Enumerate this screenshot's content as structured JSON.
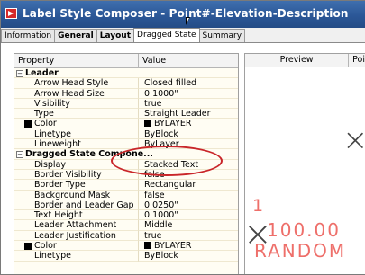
{
  "window": {
    "title": "Label Style Composer - Point#-Elevation-Description"
  },
  "tabs": [
    {
      "label": "Information",
      "bold": false,
      "active": false
    },
    {
      "label": "General",
      "bold": true,
      "active": false
    },
    {
      "label": "Layout",
      "bold": true,
      "active": false
    },
    {
      "label": "Dragged State",
      "bold": false,
      "active": true
    },
    {
      "label": "Summary",
      "bold": false,
      "active": false
    }
  ],
  "grid": {
    "property_header": "Property",
    "value_header": "Value",
    "rows": [
      {
        "kind": "cat",
        "label": "Leader",
        "toggle": "−"
      },
      {
        "kind": "item",
        "label": "Arrow Head Style",
        "value": "Closed filled"
      },
      {
        "kind": "item",
        "label": "Arrow Head Size",
        "value": "0.1000\""
      },
      {
        "kind": "item",
        "label": "Visibility",
        "value": "true"
      },
      {
        "kind": "item",
        "label": "Type",
        "value": "Straight Leader"
      },
      {
        "kind": "item",
        "label": "Color",
        "value": "BYLAYER",
        "swatch": true
      },
      {
        "kind": "item",
        "label": "Linetype",
        "value": "ByBlock"
      },
      {
        "kind": "item",
        "label": "Lineweight",
        "value": "ByLayer"
      },
      {
        "kind": "cat",
        "label": "Dragged State Compone...",
        "toggle": "−"
      },
      {
        "kind": "item",
        "label": "Display",
        "value": "Stacked Text"
      },
      {
        "kind": "item",
        "label": "Border Visibility",
        "value": "false"
      },
      {
        "kind": "item",
        "label": "Border Type",
        "value": "Rectangular"
      },
      {
        "kind": "item",
        "label": "Background Mask",
        "value": "false"
      },
      {
        "kind": "item",
        "label": "Border and Leader Gap",
        "value": "0.0250\""
      },
      {
        "kind": "item",
        "label": "Text Height",
        "value": "0.1000\""
      },
      {
        "kind": "item",
        "label": "Leader Attachment",
        "value": "Middle"
      },
      {
        "kind": "item",
        "label": "Leader Justification",
        "value": "true"
      },
      {
        "kind": "item",
        "label": "Color",
        "value": "BYLAYER",
        "swatch": true
      },
      {
        "kind": "item",
        "label": "Linetype",
        "value": "ByBlock"
      }
    ]
  },
  "preview": {
    "tab_preview": "Preview",
    "tab_point": "Poi",
    "cross_glyph": "×",
    "label_line1": "1",
    "label_line2": "100.00",
    "label_line3": "RANDOM"
  },
  "colors": {
    "title_bar": "#2b5797",
    "highlight": "#c9262a",
    "label_text": "#ee6f6a"
  }
}
